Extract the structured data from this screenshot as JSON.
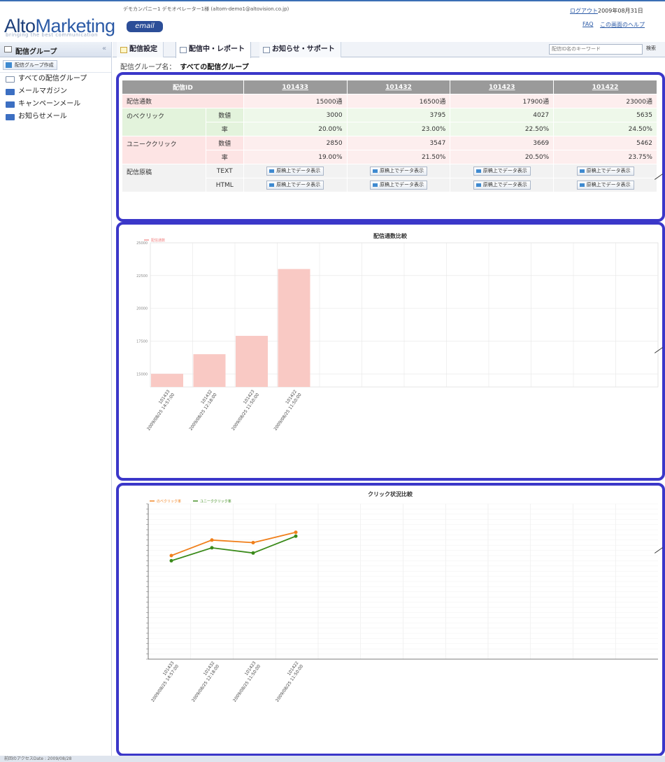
{
  "header": {
    "logo_alto": "Alto",
    "logo_marketing": "Marketing",
    "logo_badge": "email",
    "logo_tagline": "bringing the best communication",
    "user_info": "デモカンパニー1 デモオペレーター1様 (altom-demo1@altovision.co.jp)",
    "logout": "ログアウト",
    "date": "2009年08月31日",
    "faq": "FAQ",
    "help": "この画面のヘルプ"
  },
  "sidebar": {
    "title": "配信グループ",
    "collapse_icon": "«",
    "create_button": "配信グループ作成",
    "items": [
      {
        "label": "すべての配信グループ"
      },
      {
        "label": "メールマガジン"
      },
      {
        "label": "キャンペーンメール"
      },
      {
        "label": "お知らせメール"
      }
    ]
  },
  "tabs": [
    {
      "label": "配信設定"
    },
    {
      "label": "配信中・レポート"
    },
    {
      "label": "お知らせ・サポート"
    }
  ],
  "search": {
    "placeholder": "配信ID名のキーワード",
    "button": "検索"
  },
  "group": {
    "label": "配信グループ名：",
    "value": "すべての配信グループ"
  },
  "table": {
    "id_header": "配信ID",
    "ids": [
      "101433",
      "101432",
      "101423",
      "101422"
    ],
    "rows": {
      "sent": {
        "label": "配信通数",
        "values": [
          "15000通",
          "16500通",
          "17900通",
          "23000通"
        ]
      },
      "total_click": {
        "label": "のべクリック",
        "count_label": "数値",
        "rate_label": "率",
        "counts": [
          "3000",
          "3795",
          "4027",
          "5635"
        ],
        "rates": [
          "20.00%",
          "23.00%",
          "22.50%",
          "24.50%"
        ]
      },
      "unique_click": {
        "label": "ユニーククリック",
        "count_label": "数値",
        "rate_label": "率",
        "counts": [
          "2850",
          "3547",
          "3669",
          "5462"
        ],
        "rates": [
          "19.00%",
          "21.50%",
          "20.50%",
          "23.75%"
        ]
      },
      "source": {
        "label": "配信原稿",
        "text_label": "TEXT",
        "html_label": "HTML",
        "button": "原稿上でデータ表示"
      }
    }
  },
  "bar_chart_title": "配信通数比較",
  "line_chart_title": "クリック状況比較",
  "chart_data": [
    {
      "type": "bar",
      "title": "配信通数比較",
      "series": [
        {
          "name": "配信通数",
          "values": [
            15000,
            16500,
            17900,
            23000
          ]
        }
      ],
      "categories": [
        "101433 2009/08/25 14:57:00",
        "101432 2009/08/25 12:18:00",
        "101423 2009/08/25 11:50:00",
        "101422 2009/08/25 11:50:00"
      ],
      "ylim": [
        0,
        25000
      ],
      "yticks": [
        15000,
        17500,
        20000,
        22500,
        25000
      ],
      "color": "#f9c9c4"
    },
    {
      "type": "line",
      "title": "クリック状況比較",
      "categories": [
        "101433 2009/08/25 14:57:00",
        "101432 2009/08/25 12:18:00",
        "101423 2009/08/25 11:50:00",
        "101422 2009/08/25 11:50:00"
      ],
      "series": [
        {
          "name": "のべクリック率",
          "values": [
            20.0,
            23.0,
            22.5,
            24.5
          ],
          "color": "#f07f1b"
        },
        {
          "name": "ユニーククリック率",
          "values": [
            19.0,
            21.5,
            20.5,
            23.75
          ],
          "color": "#3a8a1a"
        }
      ]
    }
  ],
  "status_bar": "前回のアクセスDate : 2009/08/28"
}
